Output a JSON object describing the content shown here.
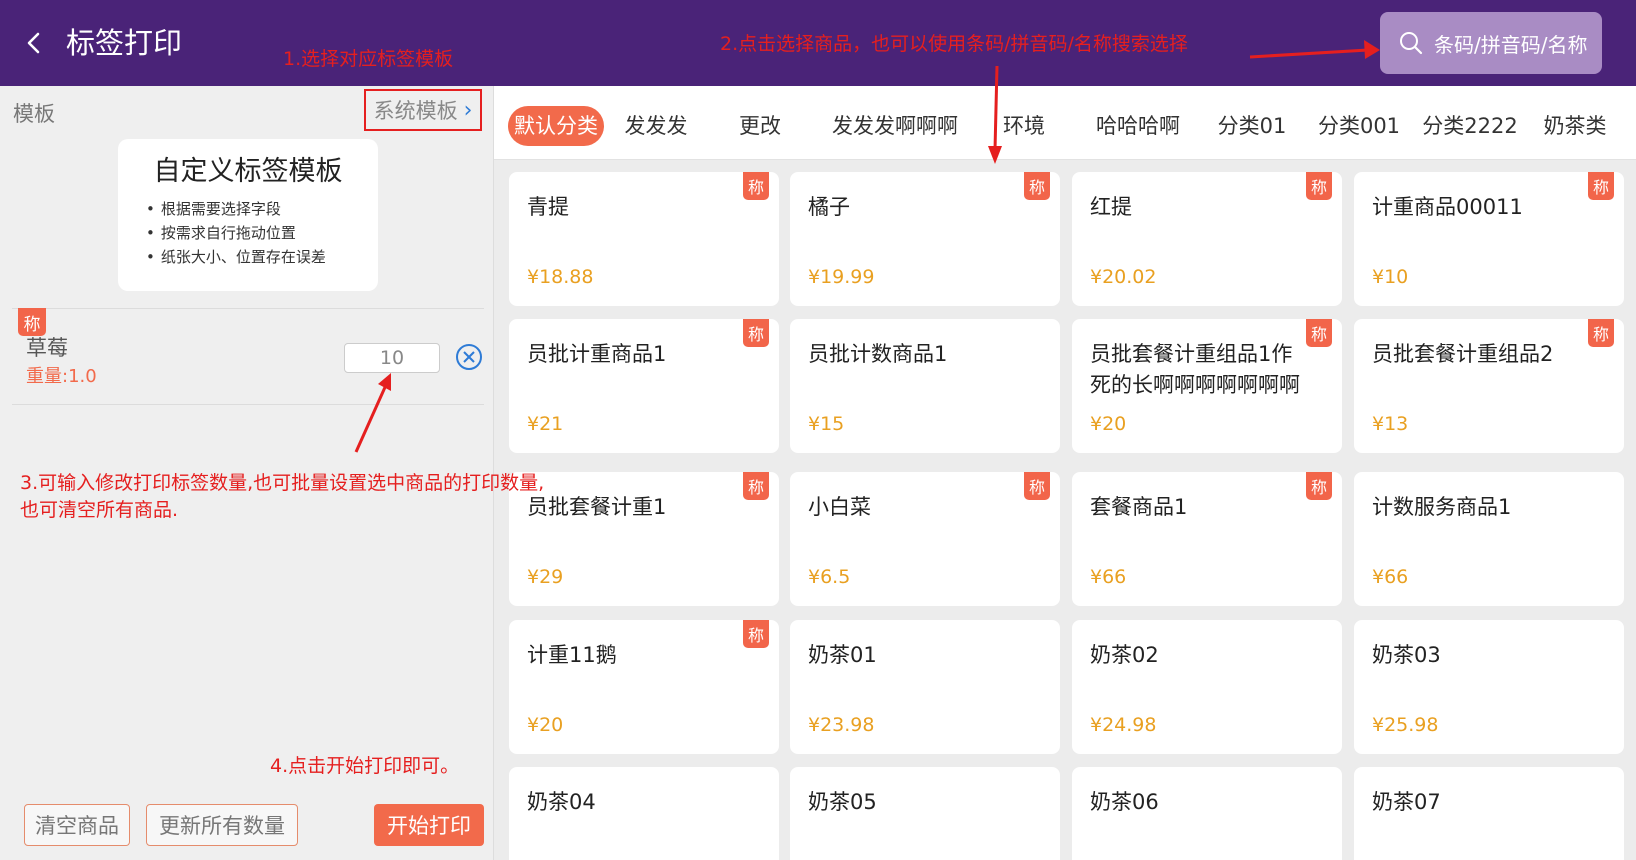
{
  "header": {
    "title": "标签打印",
    "search_placeholder": "条码/拼音码/名称"
  },
  "left_panel": {
    "template_label": "模板",
    "template_select": "系统模板",
    "template_card": {
      "title": "自定义标签模板",
      "bullets": [
        "根据需要选择字段",
        "按需求自行拖动位置",
        "纸张大小、位置存在误差"
      ]
    },
    "selected_item": {
      "badge": "称",
      "name": "草莓",
      "weight": "重量:1.0",
      "quantity": "10"
    },
    "buttons": {
      "clear": "清空商品",
      "update_all": "更新所有数量",
      "start_print": "开始打印"
    }
  },
  "categories": [
    "默认分类",
    "发发发",
    "更改",
    "发发发啊啊啊",
    "环境",
    "哈哈哈啊",
    "分类01",
    "分类001",
    "分类2222",
    "奶茶类"
  ],
  "active_category": "默认分类",
  "products": [
    {
      "name": "青提",
      "price": "¥18.88",
      "badge": "称"
    },
    {
      "name": "橘子",
      "price": "¥19.99",
      "badge": "称"
    },
    {
      "name": "红提",
      "price": "¥20.02",
      "badge": "称"
    },
    {
      "name": "计重商品00011",
      "price": "¥10",
      "badge": "称"
    },
    {
      "name": "员批计重商品1",
      "price": "¥21",
      "badge": "称"
    },
    {
      "name": "员批计数商品1",
      "price": "¥15",
      "badge": ""
    },
    {
      "name": "员批套餐计重组品1作死的长啊啊啊啊啊啊啊",
      "price": "¥20",
      "badge": "称"
    },
    {
      "name": "员批套餐计重组品2",
      "price": "¥13",
      "badge": "称"
    },
    {
      "name": "员批套餐计重1",
      "price": "¥29",
      "badge": "称"
    },
    {
      "name": "小白菜",
      "price": "¥6.5",
      "badge": "称"
    },
    {
      "name": "套餐商品1",
      "price": "¥66",
      "badge": "称"
    },
    {
      "name": "计数服务商品1",
      "price": "¥66",
      "badge": ""
    },
    {
      "name": "计重11鹅",
      "price": "¥20",
      "badge": "称"
    },
    {
      "name": "奶茶01",
      "price": "¥23.98",
      "badge": ""
    },
    {
      "name": "奶茶02",
      "price": "¥24.98",
      "badge": ""
    },
    {
      "name": "奶茶03",
      "price": "¥25.98",
      "badge": ""
    },
    {
      "name": "奶茶04",
      "price": "",
      "badge": ""
    },
    {
      "name": "奶茶05",
      "price": "",
      "badge": ""
    },
    {
      "name": "奶茶06",
      "price": "",
      "badge": ""
    },
    {
      "name": "奶茶07",
      "price": "",
      "badge": ""
    }
  ],
  "annotations": {
    "step1": "1.选择对应标签模板",
    "step2": "2.点击选择商品，也可以使用条码/拼音码/名称搜索选择",
    "step3_line1": "3.可输入修改打印标签数量,也可批量设置选中商品的打印数量,",
    "step3_line2": "也可清空所有商品.",
    "step4": "4.点击开始打印即可。"
  },
  "colors": {
    "header_bg": "#4a2378",
    "accent": "#f26a4b",
    "price": "#e9a021",
    "annotation": "#e51f1f"
  }
}
